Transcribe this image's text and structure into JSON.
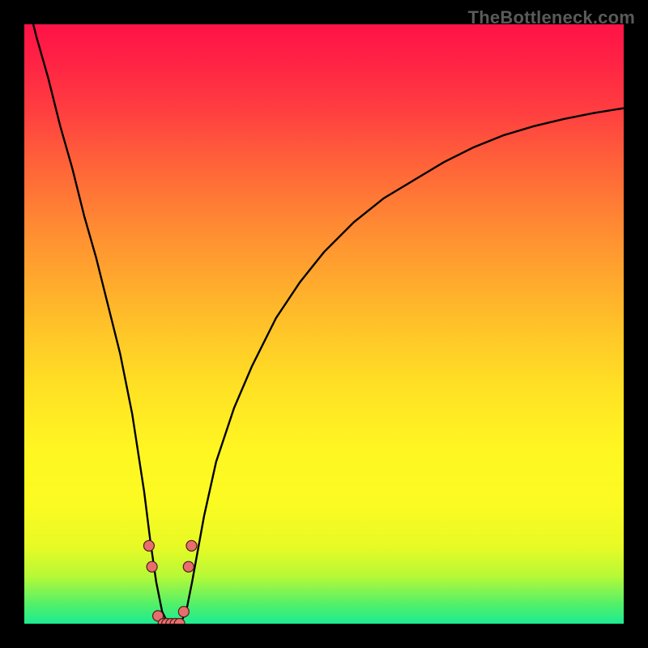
{
  "watermark": "TheBottleneck.com",
  "colors": {
    "background": "#000000",
    "curve": "#000000",
    "marker_fill": "#E96D6C",
    "marker_stroke": "#4A1E1E"
  },
  "chart_data": {
    "type": "line",
    "title": "",
    "xlabel": "",
    "ylabel": "",
    "xlim": [
      0,
      100
    ],
    "ylim": [
      0,
      100
    ],
    "x": [
      0,
      2,
      4,
      6,
      8,
      10,
      12,
      14,
      16,
      18,
      20,
      21,
      22,
      23,
      24,
      25,
      26,
      27,
      28,
      30,
      32,
      35,
      38,
      42,
      46,
      50,
      55,
      60,
      65,
      70,
      75,
      80,
      85,
      90,
      95,
      100
    ],
    "values": [
      106,
      98,
      91,
      83,
      76,
      68,
      61,
      53,
      45,
      35,
      22,
      14,
      7,
      2,
      0,
      0,
      0,
      2,
      7,
      18,
      27,
      36,
      43,
      51,
      57,
      62,
      67,
      71,
      74,
      77,
      79.5,
      81.5,
      83,
      84.2,
      85.2,
      86
    ],
    "markers": {
      "x": [
        20.8,
        21.3,
        22.3,
        23.2,
        23.8,
        24.5,
        25.2,
        25.9,
        26.6,
        27.4,
        27.9
      ],
      "y": [
        13,
        9.5,
        1.3,
        0,
        0,
        0,
        0,
        0,
        2.0,
        9.5,
        13
      ]
    },
    "gradient_stops": [
      {
        "pct": 0,
        "color": "#FF1348"
      },
      {
        "pct": 50,
        "color": "#FFC828"
      },
      {
        "pct": 80,
        "color": "#FBFB22"
      },
      {
        "pct": 100,
        "color": "#1DEB92"
      }
    ]
  }
}
